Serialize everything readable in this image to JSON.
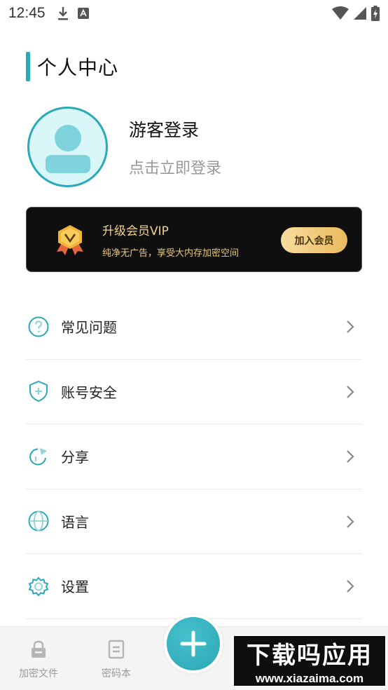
{
  "status_bar": {
    "time": "12:45",
    "icons_left": [
      "download-icon",
      "keyboard-a-icon"
    ],
    "icons_right": [
      "wifi-icon",
      "cellular-signal-icon",
      "battery-charging-icon"
    ]
  },
  "page": {
    "title": "个人中心",
    "accent_color": "#2aa9b7"
  },
  "profile": {
    "name": "游客登录",
    "subtitle": "点击立即登录"
  },
  "vip": {
    "title": "升级会员VIP",
    "description": "纯净无广告，享受大内存加密空间",
    "button_label": "加入会员",
    "icon": "vip-badge-icon"
  },
  "menu": {
    "items": [
      {
        "label": "常见问题",
        "icon": "question-circle-icon"
      },
      {
        "label": "账号安全",
        "icon": "shield-plus-icon"
      },
      {
        "label": "分享",
        "icon": "share-arrow-icon"
      },
      {
        "label": "语言",
        "icon": "globe-icon"
      },
      {
        "label": "设置",
        "icon": "gear-icon"
      }
    ]
  },
  "bottom_nav": {
    "items": [
      {
        "label": "加密文件",
        "icon": "lock-icon"
      },
      {
        "label": "密码本",
        "icon": "notebook-icon"
      }
    ],
    "fab_icon": "plus-icon"
  },
  "watermark": {
    "title": "下载吗应用",
    "url": "www.xiazaima.com"
  }
}
